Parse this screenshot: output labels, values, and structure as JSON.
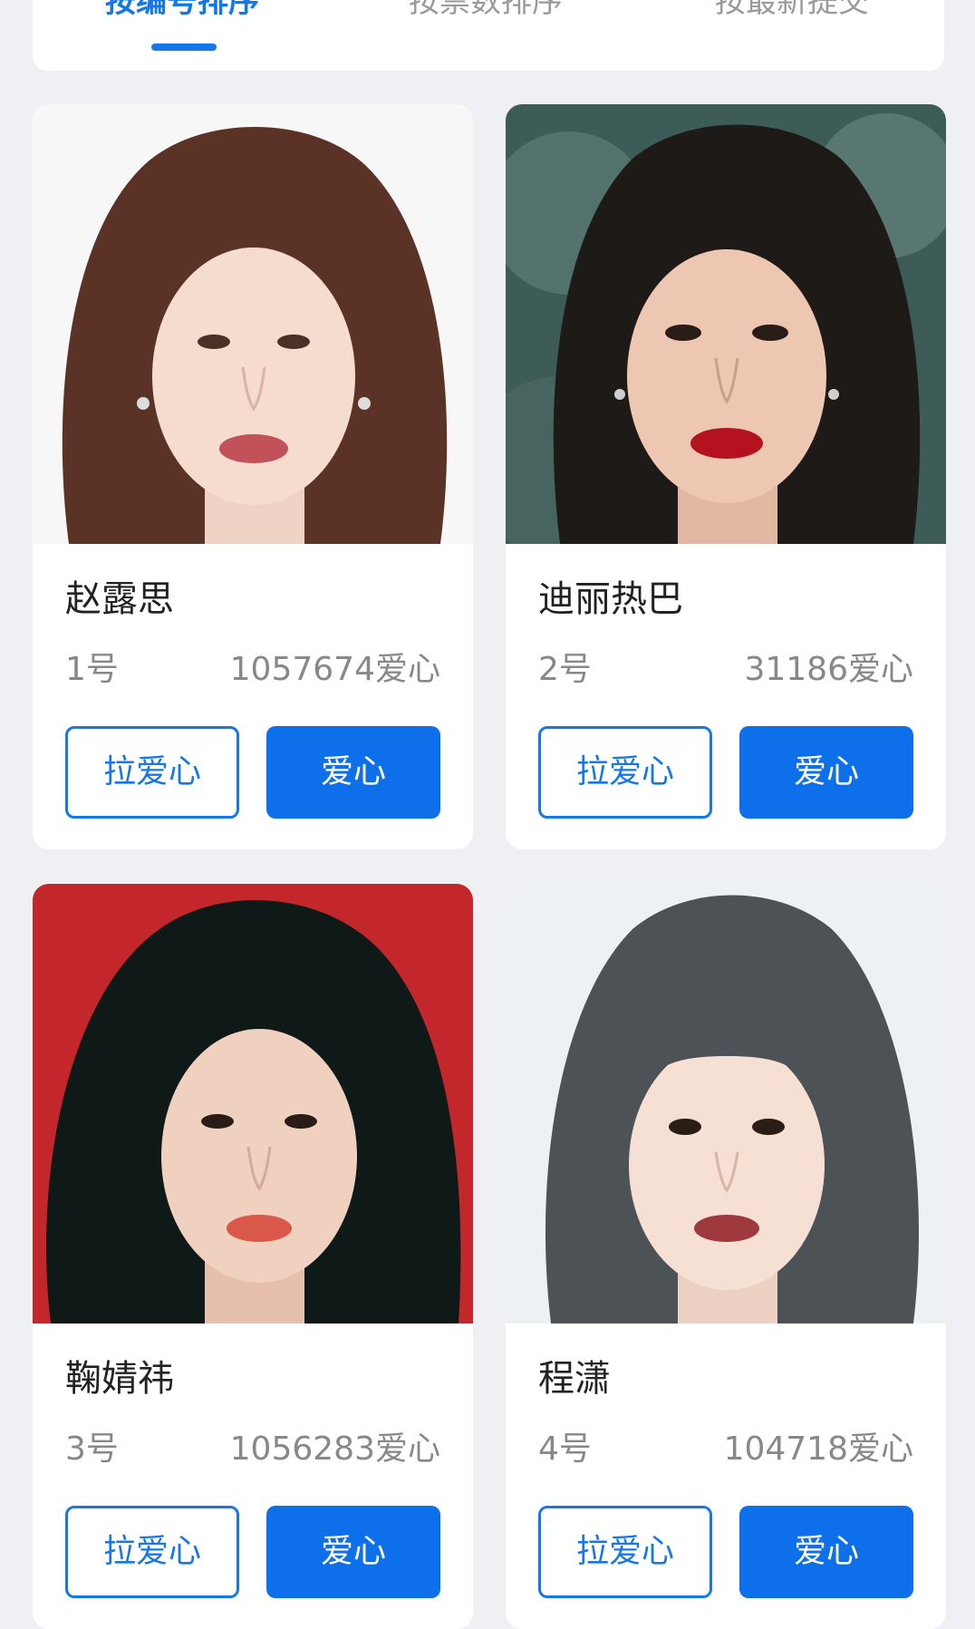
{
  "tabs": [
    {
      "label": "按编号排序",
      "active": true
    },
    {
      "label": "按票数排序",
      "active": false
    },
    {
      "label": "按最新提交",
      "active": false
    }
  ],
  "colors": {
    "accent": "#1677e8",
    "button_fill": "#0d6fea",
    "background": "#eef0f4"
  },
  "cards": [
    {
      "name": "赵露思",
      "number": "1号",
      "votes": "1057674爱心",
      "pull_label": "拉爱心",
      "vote_label": "爱心"
    },
    {
      "name": "迪丽热巴",
      "number": "2号",
      "votes": "31186爱心",
      "pull_label": "拉爱心",
      "vote_label": "爱心"
    },
    {
      "name": "鞠婧祎",
      "number": "3号",
      "votes": "1056283爱心",
      "pull_label": "拉爱心",
      "vote_label": "爱心"
    },
    {
      "name": "程潇",
      "number": "4号",
      "votes": "104718爱心",
      "pull_label": "拉爱心",
      "vote_label": "爱心"
    }
  ]
}
